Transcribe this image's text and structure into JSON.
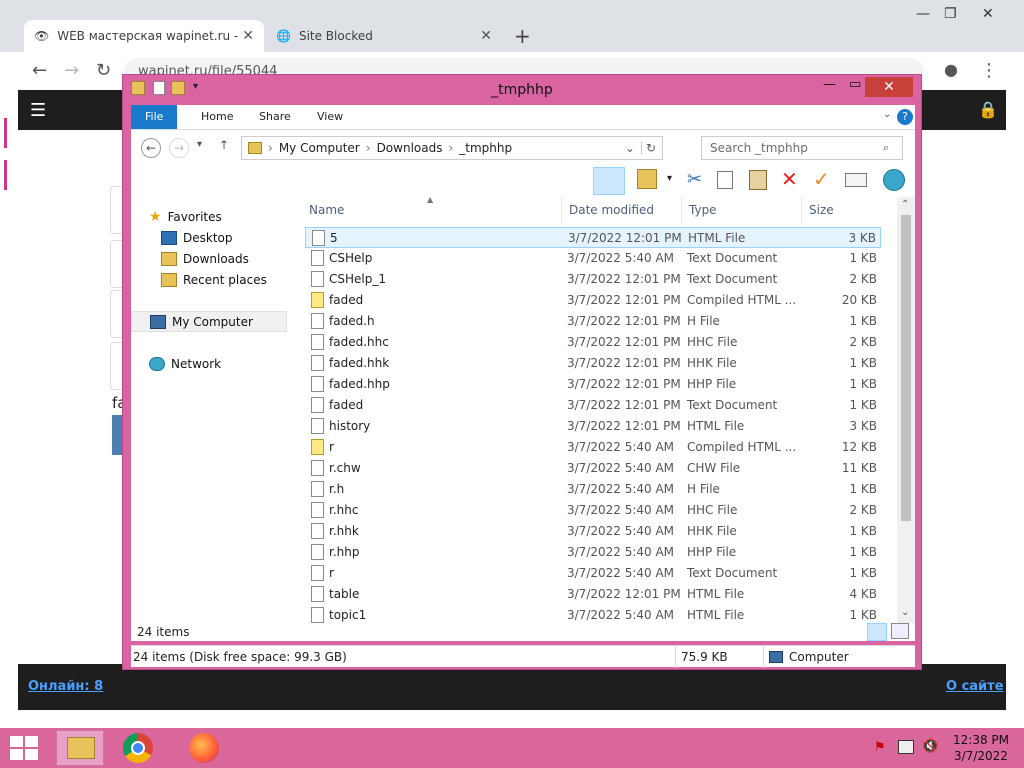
{
  "browser": {
    "tabs": [
      {
        "title": "WEB мастерская wapinet.ru - _tmphhp",
        "active": true
      },
      {
        "title": "Site Blocked",
        "active": false
      }
    ],
    "url": "wapinet.ru/file/55044"
  },
  "site": {
    "footer_left": "Онлайн: 8",
    "footer_right": "О сайте",
    "fragment": "fa"
  },
  "explorer": {
    "title": "_tmphhp",
    "ribbon_tabs": [
      "File",
      "Home",
      "Share",
      "View"
    ],
    "breadcrumb": [
      "My Computer",
      "Downloads",
      "_tmphhp"
    ],
    "search_placeholder": "Search _tmphhp",
    "nav": {
      "favorites": "Favorites",
      "desktop": "Desktop",
      "downloads": "Downloads",
      "recent": "Recent places",
      "computer": "My Computer",
      "network": "Network"
    },
    "columns": {
      "name": "Name",
      "date": "Date modified",
      "type": "Type",
      "size": "Size"
    },
    "files": [
      {
        "name": "5",
        "date": "3/7/2022 12:01 PM",
        "type": "HTML File",
        "size": "3 KB",
        "icon": "doc-icon",
        "selected": true
      },
      {
        "name": "CSHelp",
        "date": "3/7/2022 5:40 AM",
        "type": "Text Document",
        "size": "1 KB",
        "icon": "doc-icon"
      },
      {
        "name": "CSHelp_1",
        "date": "3/7/2022 12:01 PM",
        "type": "Text Document",
        "size": "2 KB",
        "icon": "doc-icon"
      },
      {
        "name": "faded",
        "date": "3/7/2022 12:01 PM",
        "type": "Compiled HTML ...",
        "size": "20 KB",
        "icon": "chm-icon"
      },
      {
        "name": "faded.h",
        "date": "3/7/2022 12:01 PM",
        "type": "H File",
        "size": "1 KB",
        "icon": "doc-icon"
      },
      {
        "name": "faded.hhc",
        "date": "3/7/2022 12:01 PM",
        "type": "HHC File",
        "size": "2 KB",
        "icon": "doc-icon"
      },
      {
        "name": "faded.hhk",
        "date": "3/7/2022 12:01 PM",
        "type": "HHK File",
        "size": "1 KB",
        "icon": "doc-icon"
      },
      {
        "name": "faded.hhp",
        "date": "3/7/2022 12:01 PM",
        "type": "HHP File",
        "size": "1 KB",
        "icon": "doc-icon"
      },
      {
        "name": "faded",
        "date": "3/7/2022 12:01 PM",
        "type": "Text Document",
        "size": "1 KB",
        "icon": "doc-icon"
      },
      {
        "name": "history",
        "date": "3/7/2022 12:01 PM",
        "type": "HTML File",
        "size": "3 KB",
        "icon": "doc-icon"
      },
      {
        "name": "r",
        "date": "3/7/2022 5:40 AM",
        "type": "Compiled HTML ...",
        "size": "12 KB",
        "icon": "chm-icon"
      },
      {
        "name": "r.chw",
        "date": "3/7/2022 5:40 AM",
        "type": "CHW File",
        "size": "11 KB",
        "icon": "doc-icon"
      },
      {
        "name": "r.h",
        "date": "3/7/2022 5:40 AM",
        "type": "H File",
        "size": "1 KB",
        "icon": "doc-icon"
      },
      {
        "name": "r.hhc",
        "date": "3/7/2022 5:40 AM",
        "type": "HHC File",
        "size": "2 KB",
        "icon": "doc-icon"
      },
      {
        "name": "r.hhk",
        "date": "3/7/2022 5:40 AM",
        "type": "HHK File",
        "size": "1 KB",
        "icon": "doc-icon"
      },
      {
        "name": "r.hhp",
        "date": "3/7/2022 5:40 AM",
        "type": "HHP File",
        "size": "1 KB",
        "icon": "doc-icon"
      },
      {
        "name": "r",
        "date": "3/7/2022 5:40 AM",
        "type": "Text Document",
        "size": "1 KB",
        "icon": "doc-icon"
      },
      {
        "name": "table",
        "date": "3/7/2022 12:01 PM",
        "type": "HTML File",
        "size": "4 KB",
        "icon": "doc-icon"
      },
      {
        "name": "topic1",
        "date": "3/7/2022 5:40 AM",
        "type": "HTML File",
        "size": "1 KB",
        "icon": "doc-icon"
      }
    ],
    "item_count": "24 items",
    "status_left": "24 items (Disk free space: 99.3 GB)",
    "status_size": "75.9 KB",
    "status_location": "Computer"
  },
  "taskbar": {
    "time": "12:38 PM",
    "date": "3/7/2022"
  },
  "colors": {
    "window_frame": "#d964a1",
    "taskbar": "#d9679c",
    "ribbon_file": "#1979ca",
    "selection": "#e5f3ff"
  }
}
